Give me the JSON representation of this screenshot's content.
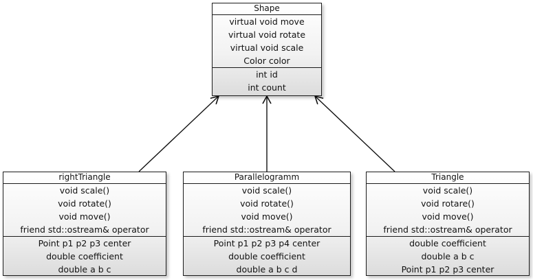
{
  "diagram": {
    "type": "uml-class",
    "classes": [
      {
        "id": "shape",
        "name": "Shape",
        "methods": [
          "virtual void move",
          "virtual void rotate",
          "virtual void scale",
          "Color color"
        ],
        "fields": [
          "int id",
          "int count"
        ]
      },
      {
        "id": "right-triangle",
        "name": "rightTriangle",
        "methods": [
          "void scale()",
          "void rotate()",
          "void move()",
          "friend std::ostream& operator"
        ],
        "fields": [
          "Point p1 p2 p3 center",
          "double coefficient",
          "double a b c"
        ]
      },
      {
        "id": "parallelogramm",
        "name": "Parallelogramm",
        "methods": [
          "void scale()",
          "void rotate()",
          "void move()",
          "friend std::ostream& operator"
        ],
        "fields": [
          "Point p1 p2 p3 p4 center",
          "double coefficient",
          "double a b c d"
        ]
      },
      {
        "id": "triangle",
        "name": "Triangle",
        "methods": [
          "void scale()",
          "void rotare()",
          "void move()",
          "friend std::ostream& operator"
        ],
        "fields": [
          "double coefficient",
          "double a b c",
          "Point p1 p2 p3 center"
        ]
      }
    ],
    "relations": [
      {
        "from": "right-triangle",
        "to": "shape",
        "kind": "inheritance"
      },
      {
        "from": "parallelogramm",
        "to": "shape",
        "kind": "inheritance"
      },
      {
        "from": "triangle",
        "to": "shape",
        "kind": "inheritance"
      }
    ]
  }
}
